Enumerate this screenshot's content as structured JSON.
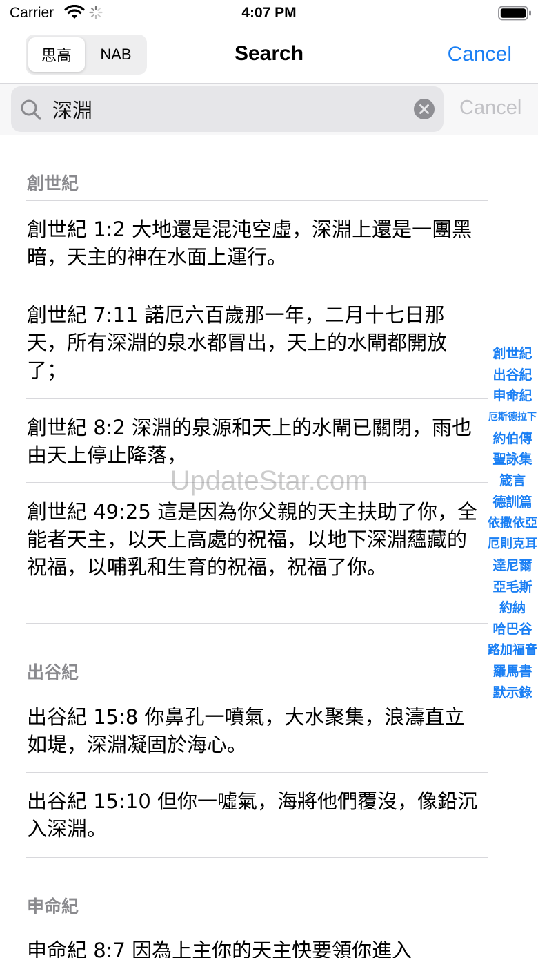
{
  "status_bar": {
    "carrier": "Carrier",
    "time": "4:07 PM"
  },
  "nav": {
    "segments": [
      "思高",
      "NAB"
    ],
    "selected_segment": 0,
    "title": "Search",
    "cancel_label": "Cancel"
  },
  "search": {
    "query": "深淵",
    "cancel_label": "Cancel"
  },
  "sections": [
    {
      "header": "創世紀",
      "rows": [
        "創世紀 1:2 大地還是混沌空虛，深淵上還是一團黑暗，天主的神在水面上運行。",
        "創世紀 7:11 諾厄六百歲那一年，二月十七日那天，所有深淵的泉水都冒出，天上的水閘都開放了；",
        "創世紀 8:2 深淵的泉源和天上的水閘已關閉，雨也由天上停止降落，",
        "創世紀 49:25 這是因為你父親的天主扶助了你，全能者天主，以天上高處的祝福，以地下深淵蘊藏的祝福，以哺乳和生育的祝福，祝福了你。"
      ]
    },
    {
      "header": "出谷紀",
      "rows": [
        "出谷紀 15:8 你鼻孔一噴氣，大水聚集，浪濤直立如堤，深淵凝固於海心。",
        "出谷紀 15:10 但你一噓氣，海將他們覆沒，像鉛沉入深淵。"
      ]
    },
    {
      "header": "申命紀",
      "rows": [
        "申命紀 8:7 因為上主你的天主快要領你進入"
      ]
    }
  ],
  "index": [
    "創世紀",
    "出谷紀",
    "申命紀",
    "厄斯德拉下",
    "約伯傳",
    "聖詠集",
    "箴言",
    "德訓篇",
    "依撒依亞",
    "厄則克耳",
    "達尼爾",
    "亞毛斯",
    "約納",
    "哈巴谷",
    "路加福音",
    "羅馬書",
    "默示錄"
  ],
  "watermark": "UpdateStar.com",
  "colors": {
    "accent": "#1a7ff4",
    "secondary_text": "#8a8a8e",
    "search_field": "#e6e6e9"
  }
}
